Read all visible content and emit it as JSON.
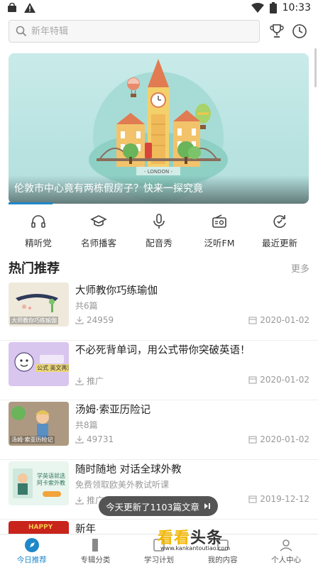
{
  "status_bar": {
    "time": "10:33"
  },
  "search": {
    "placeholder": "新年特辑"
  },
  "banner": {
    "caption": "伦敦市中心竟有两栋假房子？快来一探究竟",
    "sign_text": "- LONDON -"
  },
  "quick_nav": [
    {
      "label": "精听党",
      "icon": "headphones-icon"
    },
    {
      "label": "名师播客",
      "icon": "graduation-cap-icon"
    },
    {
      "label": "配音秀",
      "icon": "microphone-icon"
    },
    {
      "label": "泛听FM",
      "icon": "radio-icon"
    },
    {
      "label": "最近更新",
      "icon": "refresh-icon"
    }
  ],
  "section": {
    "title": "热门推荐",
    "more": "更多"
  },
  "items": [
    {
      "title": "大师教你巧练瑜伽",
      "sub": "共6篇",
      "meta": "24959",
      "meta_icon": "download-icon",
      "date": "2020-01-02",
      "thumb_label": "大师教你巧练瑜伽"
    },
    {
      "title": "不必死背单词，用公式带你突破英语！",
      "sub": "",
      "meta": "推广",
      "meta_icon": "download-icon",
      "date": "2020-01-02",
      "thumb_label": "公式 英文再没怕过!"
    },
    {
      "title": "汤姆·索亚历险记",
      "sub": "共8篇",
      "meta": "49731",
      "meta_icon": "download-icon",
      "date": "2020-01-02",
      "thumb_label": "汤姆·索亚历险记"
    },
    {
      "title": "随时随地 对话全球外教",
      "sub": "免费领取欧美外教试听课",
      "meta": "推广",
      "meta_icon": "download-icon",
      "date": "2019-12-12",
      "thumb_label": "学英语就选 阿卡索外教"
    },
    {
      "title": "新年",
      "sub": "",
      "meta": "",
      "meta_icon": "",
      "date": "",
      "thumb_label": "HAPPY"
    }
  ],
  "toast": {
    "text": "今天更新了1103篇文章"
  },
  "tabs": [
    {
      "label": "今日推荐",
      "active": true
    },
    {
      "label": "专辑分类",
      "active": false
    },
    {
      "label": "学习计划",
      "active": false
    },
    {
      "label": "我的内容",
      "active": false
    },
    {
      "label": "个人中心",
      "active": false
    }
  ],
  "watermark": {
    "brand": "看看",
    "brand2": "头条",
    "url": "www.kankantoutiao.com"
  },
  "colors": {
    "accent": "#1e88c9",
    "watermark_yellow": "#f2b705"
  }
}
